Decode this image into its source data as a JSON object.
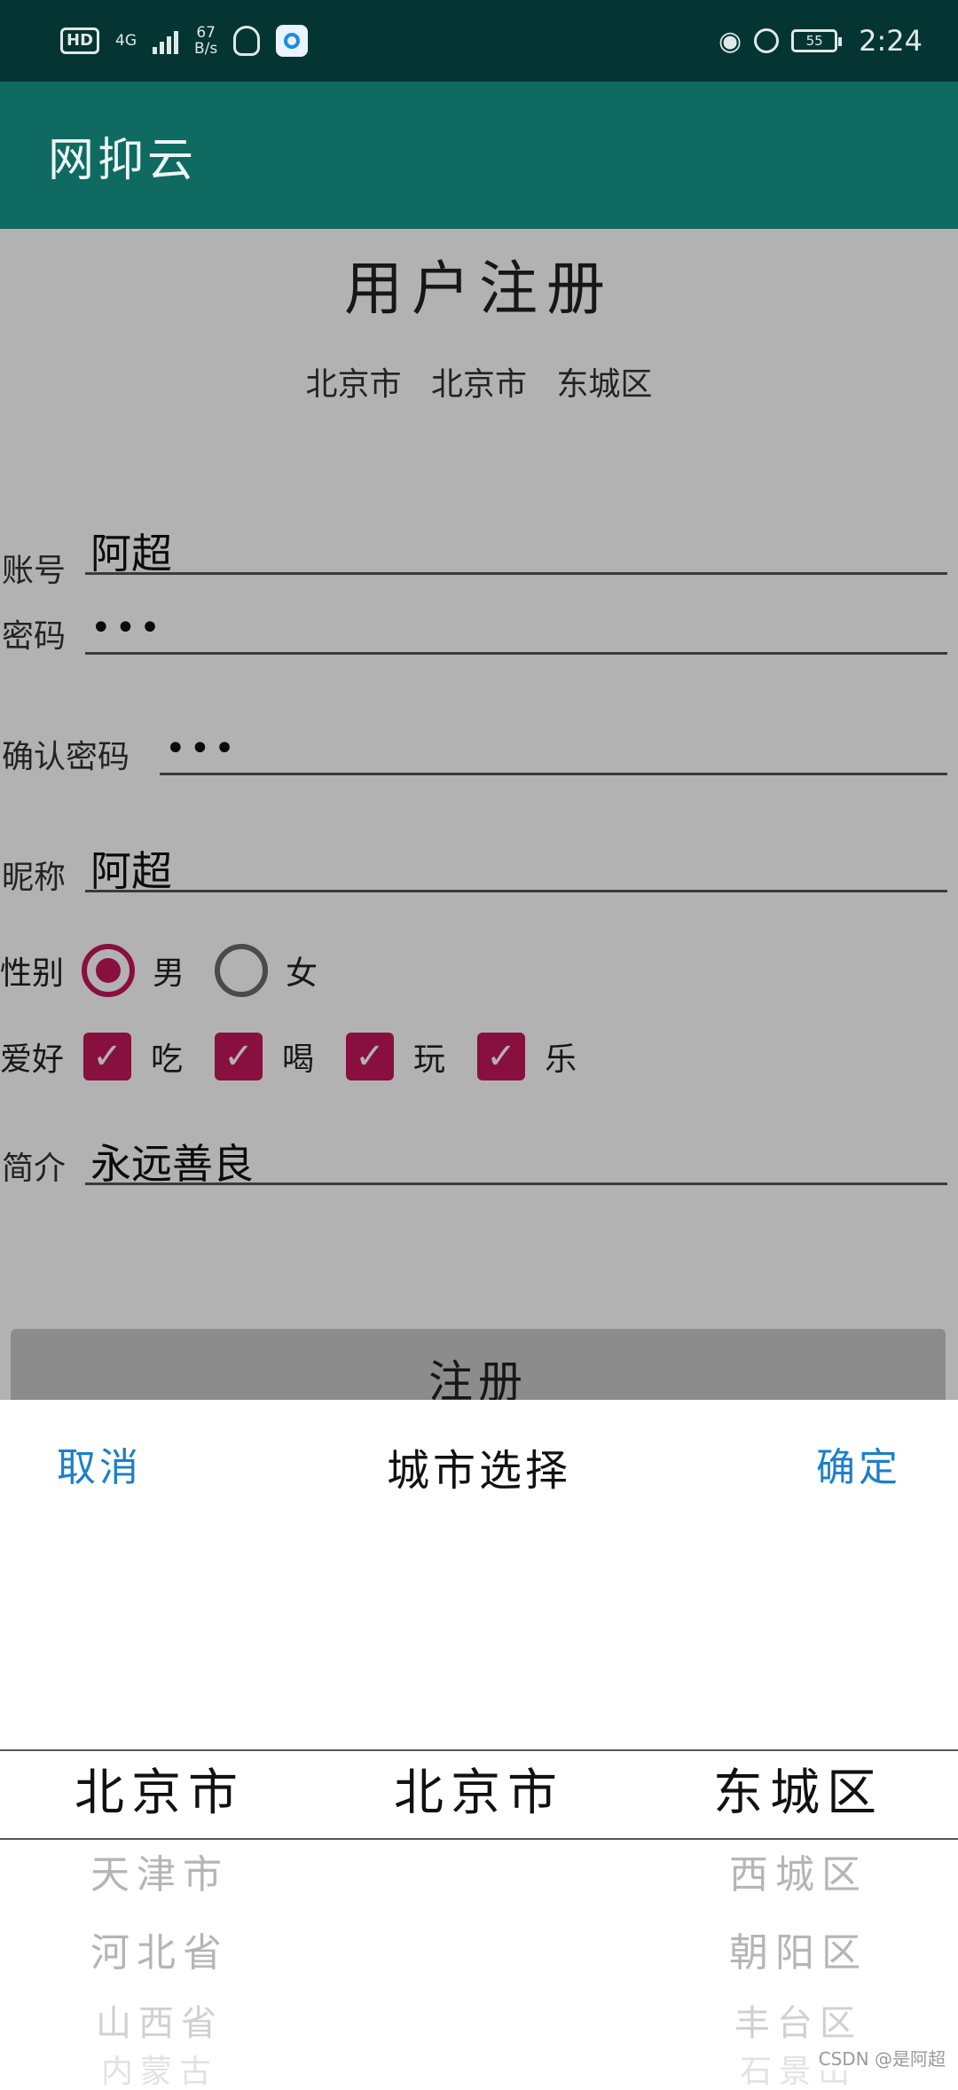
{
  "status_bar": {
    "hd": "HD",
    "network": "4G",
    "speed_value": "67",
    "speed_unit": "B/s",
    "battery": "55",
    "time": "2:24"
  },
  "app_bar": {
    "title": "网抑云"
  },
  "form": {
    "title": "用户注册",
    "region_text": "北京市 北京市 东城区",
    "account": {
      "label": "账号",
      "value": "阿超"
    },
    "password": {
      "label": "密码",
      "value": "•••"
    },
    "confirm_password": {
      "label": "确认密码",
      "value": "•••"
    },
    "nickname": {
      "label": "昵称",
      "value": "阿超"
    },
    "gender": {
      "label": "性别",
      "options": [
        "男",
        "女"
      ],
      "selected": "男"
    },
    "hobbies": {
      "label": "爱好",
      "options": [
        "吃",
        "喝",
        "玩",
        "乐"
      ],
      "checked": [
        "吃",
        "喝",
        "玩",
        "乐"
      ]
    },
    "intro": {
      "label": "简介",
      "value": "永远善良"
    },
    "register_label": "注册"
  },
  "city_picker": {
    "cancel_label": "取消",
    "title": "城市选择",
    "confirm_label": "确定",
    "province": {
      "selected": "北京市",
      "options": [
        "天津市",
        "河北省",
        "山西省",
        "内蒙古"
      ]
    },
    "city": {
      "selected": "北京市",
      "options": []
    },
    "district": {
      "selected": "东城区",
      "options": [
        "西城区",
        "朝阳区",
        "丰台区",
        "石景山"
      ]
    }
  },
  "watermark": "CSDN @是阿超"
}
